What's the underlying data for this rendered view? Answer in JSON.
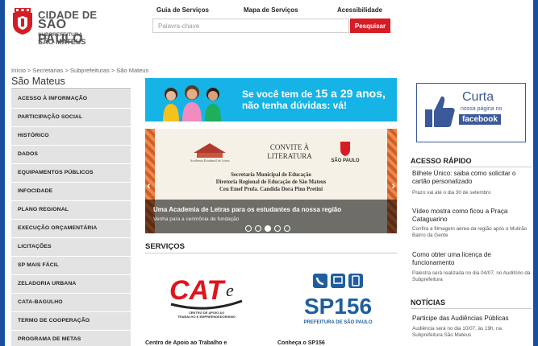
{
  "header": {
    "logo_line1": "CIDADE DE",
    "logo_line2": "SÃO PAULO",
    "logo_line3": "SUBPREFEITURA",
    "logo_line4": "SÃO MATEUS",
    "links": [
      "Guia de Serviços",
      "Mapa de Serviços",
      "Acessibilidade"
    ],
    "search_placeholder": "Palavra-chave",
    "search_button": "Pesquisar"
  },
  "breadcrumb": "Início > Secretarias > Subprefeituras > São Mateus",
  "page_title": "São Mateus",
  "menu": [
    "ACESSO À INFORMAÇÃO",
    "PARTICIPAÇÃO SOCIAL",
    "HISTÓRICO",
    "DADOS",
    "EQUIPAMENTOS PÚBLICOS",
    "INFOCIDADE",
    "PLANO REGIONAL",
    "EXECUÇÃO ORÇAMENTÁRIA",
    "LICITAÇÕES",
    "SP MAIS FÁCIL",
    "ZELADORIA URBANA",
    "CATA-BAGULHO",
    "TERMO DE COOPERAÇÃO",
    "PROGRAMA DE METAS"
  ],
  "banner": {
    "text_a": "Se você tem de ",
    "text_b": "15 a 29 anos,",
    "text_c": "não tenha dúvidas: vá!"
  },
  "carousel": {
    "invite_title": "CONVITE À LITERATURA",
    "invite_body": [
      "Secretaria Municipal de Educação",
      "Diretoria Regional de Educação de São Mateus",
      "Ceu Emef Profa. Candida Dora Pino Pretini"
    ],
    "academy_label": "Academia Estudantil de Letras",
    "sp_logo_label": "SÃO PAULO",
    "caption_title": "Uma Academia de Letras para os estudantes da nossa região",
    "caption_sub": "Venha para a cerimônia de fundação",
    "slides": 5,
    "active_slide": 3
  },
  "services": {
    "title": "SERVIÇOS",
    "cat_label": "CATe",
    "cat_sub": "CENTRO DE APOIO AO TRABALHO E EMPREENDEDORISMO",
    "sp156_label": "SP156",
    "sp156_sub": "PREFEITURA DE SÃO PAULO",
    "item1": "Centro de Apoio ao Trabalho e",
    "item2": "Conheça o SP156"
  },
  "facebook": {
    "curta": "Curta",
    "sub": "nossa página no",
    "name": "facebook"
  },
  "acesso_rapido": {
    "title": "ACESSO RÁPIDO",
    "items": [
      {
        "title": "Bilhete Único: saiba como solicitar o cartão personalizado",
        "meta": "Prazo vai até o dia 30 de setembro"
      },
      {
        "title": "Vídeo mostra como ficou a Praça Cataguarino",
        "meta": "Confira a filmagem aérea da região após o Mutirão Bairro da Gente"
      },
      {
        "title": "Como obter uma licença de funcionamento",
        "meta": "Palestra será realizada no dia 04/07, no Auditório da Subprefeitura"
      }
    ]
  },
  "noticias": {
    "title": "NOTÍCIAS",
    "items": [
      {
        "title": "Participe das Audiências Públicas",
        "meta": "Audiência será no dia 10/07, às 19h, na Subprefeitura São Mateus"
      }
    ]
  }
}
